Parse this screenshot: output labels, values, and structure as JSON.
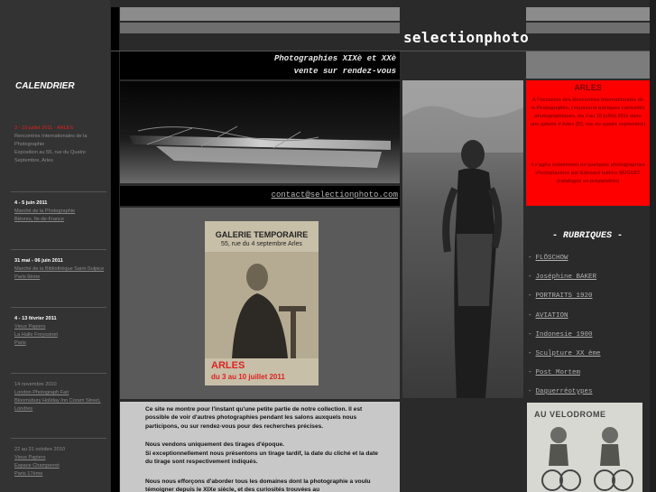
{
  "site": {
    "title": "selectionphoto",
    "tagline_1": "Photographies XIXè et XXè",
    "tagline_2": "vente sur rendez-vous",
    "contact": "contact@selectionphoto.com"
  },
  "calendar": {
    "title": "CALENDRIER",
    "events": [
      {
        "date": "3 - 10 juillet 2011 - ARLES",
        "highlight": true,
        "lines": [
          "Rencontres Internationales de la Photographie",
          "Exposition au 55, rue du Quatre Septembre, Arles"
        ],
        "links": []
      },
      {
        "date": "4 - 5 juin 2011",
        "highlight": false,
        "links": [
          "Marché de la Photographie",
          "Bièvres, Ile-de-France"
        ],
        "lines": []
      },
      {
        "date": "31 mai - 06 juin 2011",
        "highlight": false,
        "links": [
          "Marché de la Bibliothèque Saint-Sulpice Paris 6ème"
        ],
        "lines": []
      },
      {
        "date": "4 - 13 février 2011",
        "highlight": false,
        "links": [
          "Vieux Papiers",
          "La Halle Freyssinet"
        ],
        "lines": [
          "Paris"
        ]
      },
      {
        "date": "14 novembre 2010",
        "highlight": false,
        "links": [
          "London Photograph Fair",
          "Bloomsbury Holiday Inn Coram Street, Londres"
        ],
        "lines": []
      },
      {
        "date": "22 au 31 octobre 2010",
        "highlight": false,
        "links": [
          "Vieux Papiers",
          "Espace Champerret",
          "Paris 17ème"
        ],
        "lines": []
      }
    ]
  },
  "poster": {
    "line1": "GALERIE TEMPORAIRE",
    "line2": "55, rue du 4 septembre Arles",
    "city": "ARLES",
    "dates": "du 3 au 10 juillet 2011"
  },
  "intro": {
    "p1": "Ce site ne montre pour l'instant qu'une petite partie de notre collection. Il est possible de voir d'autres photographies pendant les salons auxquels nous participons, ou sur rendez-vous pour des recherches précises.",
    "p2": "Nous vendons uniquement des tirages d'époque.",
    "p3": "Si exceptionnellement nous présentons un tirage tardif, la date du cliché et la date du tirage sont respectivement indiqués.",
    "p4": "Nous nous efforçons d'aborder tous les domaines dont la photographie a voulu témoigner depuis le XIXe siècle, et des curiosités trouvées au"
  },
  "arles": {
    "title": "ARLES",
    "p1": "A l'occasion des Rencontres Internationales de la Photographie, j'exposerai quelques curiosités photographiques, du 3 au 10 juillet 2011 dans une galerie d'Arles (55, rue du quatre septembre)",
    "p2": "Il s'agira notamment de quelques photographies d'ectoplasmes par Edouard Isidore BUGUET (catalogue en préparation)"
  },
  "rubriques": {
    "title": "- RUBRIQUES -",
    "items": [
      "FLÖSCHOW",
      "Joséphine BAKER",
      "PORTRAITS 1920",
      "AVIATION",
      "Indonesie 1900",
      "Sculpture XX ème",
      "Post Mortem",
      "Daguerréotypes"
    ]
  },
  "velodrome": {
    "sign": "AU VELODROME"
  },
  "colors": {
    "accent_red": "#ff0000",
    "background": "#2a2a2a",
    "sidebar": "#333333"
  }
}
